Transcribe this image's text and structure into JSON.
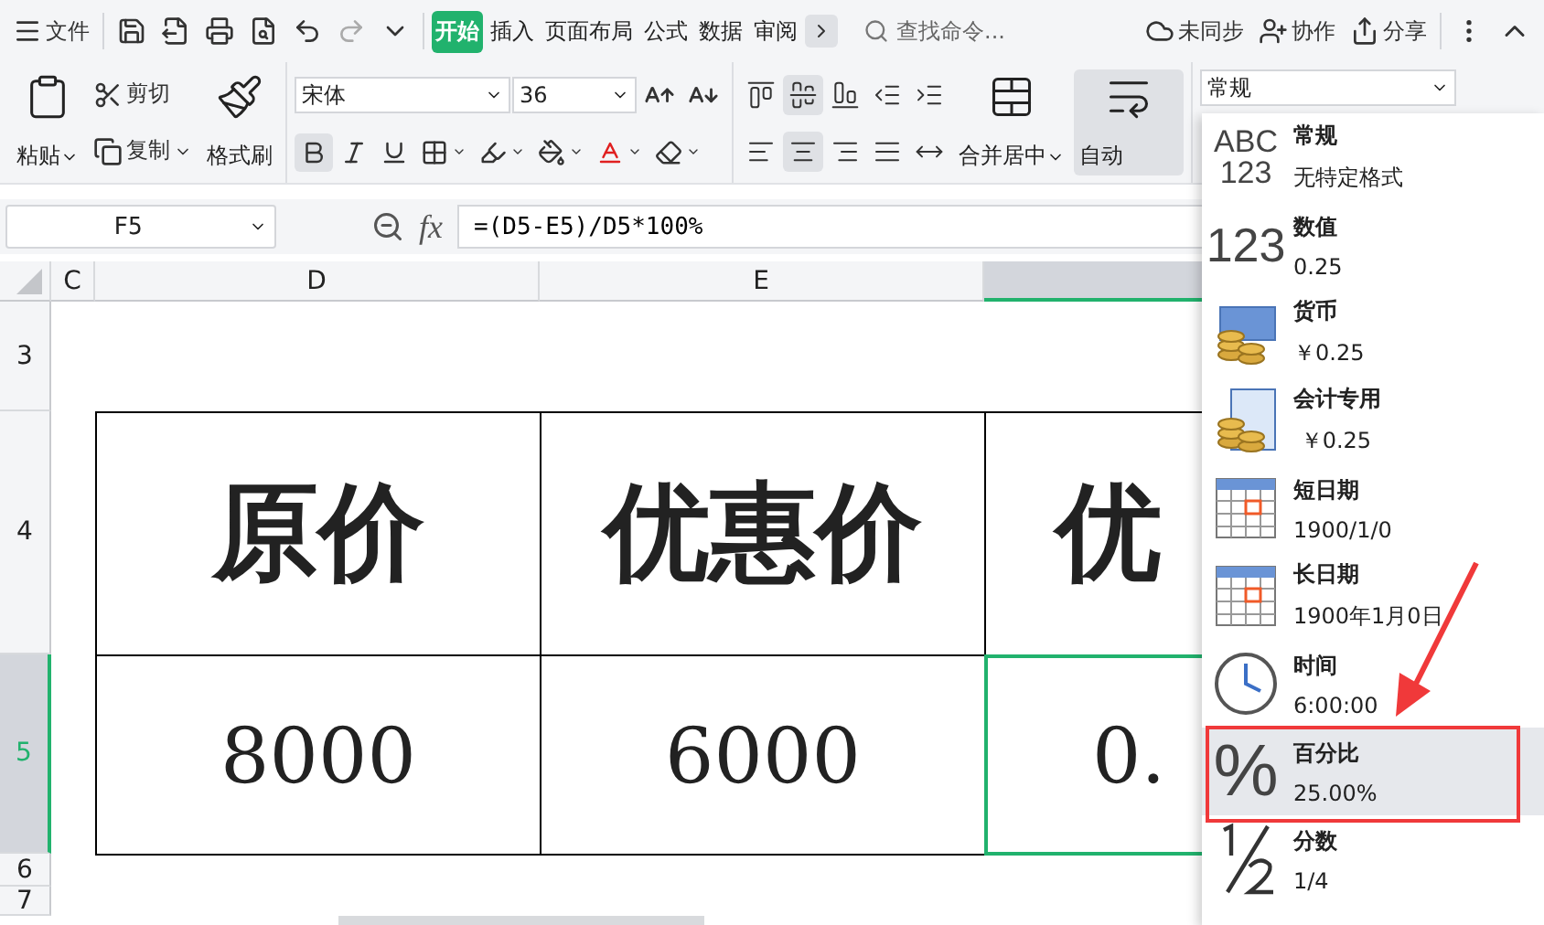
{
  "menubar": {
    "file_label": "文件",
    "tabs": [
      {
        "label": "开始",
        "selected": true
      },
      {
        "label": "插入",
        "selected": false
      },
      {
        "label": "页面布局",
        "selected": false
      },
      {
        "label": "公式",
        "selected": false
      },
      {
        "label": "数据",
        "selected": false
      },
      {
        "label": "审阅",
        "selected": false
      }
    ],
    "search": {
      "placeholder": "查找命令..."
    },
    "actions": [
      {
        "kind": "cloud",
        "label": "未同步"
      },
      {
        "kind": "person",
        "label": "协作"
      },
      {
        "kind": "share",
        "label": "分享"
      }
    ]
  },
  "ribbon": {
    "paste": "粘贴",
    "cut": "剪切",
    "copy": "复制",
    "format_painter": "格式刷",
    "font": {
      "name": "宋体",
      "size": "36",
      "bold": true
    },
    "align_buttons": [
      {
        "kind": "top",
        "selected": false
      },
      {
        "kind": "middle",
        "selected": true
      },
      {
        "kind": "bottom",
        "selected": false
      },
      {
        "kind": "outdent",
        "selected": false
      },
      {
        "kind": "indent",
        "selected": false
      },
      {
        "kind": "left",
        "selected": false
      },
      {
        "kind": "center",
        "selected": true
      },
      {
        "kind": "right",
        "selected": false
      },
      {
        "kind": "justify",
        "selected": false
      },
      {
        "kind": "distribute",
        "selected": false
      }
    ],
    "merge": "合并居中",
    "wrap": {
      "label": "自动",
      "on": true
    },
    "number_format": "常规"
  },
  "formula_bar": {
    "cell": "F5",
    "fx": "fx",
    "formula": "=(D5-E5)/D5*100%"
  },
  "sheet": {
    "columns": [
      {
        "label": "C",
        "selected": false
      },
      {
        "label": "D",
        "selected": false
      },
      {
        "label": "E",
        "selected": false
      },
      {
        "selected": true
      }
    ],
    "rows": [
      {
        "label": "3",
        "selected": false,
        "cells": []
      },
      {
        "label": "4",
        "selected": false,
        "kind": "header",
        "cells": [
          {
            "text": ""
          },
          {
            "text": "原价",
            "selected": false
          },
          {
            "text": "优惠价",
            "selected": false
          },
          {
            "text": "优",
            "selected": false
          }
        ]
      },
      {
        "label": "5",
        "selected": true,
        "kind": "value",
        "cells": [
          {
            "text": ""
          },
          {
            "text": "8000",
            "selected": false
          },
          {
            "text": "6000",
            "selected": false
          },
          {
            "text": "0.",
            "selected": true
          }
        ]
      },
      {
        "label": "6",
        "selected": false,
        "cells": []
      },
      {
        "label": "7",
        "selected": false,
        "cells": []
      }
    ]
  },
  "format_menu": {
    "items": [
      {
        "kind": "general",
        "icon_lines": [
          "ABC",
          "123"
        ],
        "title": "常规",
        "example": "无特定格式",
        "selected": false
      },
      {
        "kind": "number",
        "icon_lines": [
          "123"
        ],
        "title": "数值",
        "example": "0.25",
        "selected": false
      },
      {
        "kind": "currency",
        "title": "货币",
        "example": "￥0.25",
        "selected": false
      },
      {
        "kind": "accounting",
        "title": "会计专用",
        "example": " ￥0.25",
        "selected": false
      },
      {
        "kind": "short_date",
        "title": "短日期",
        "example": "1900/1/0",
        "selected": false
      },
      {
        "kind": "long_date",
        "title": "长日期",
        "example": "1900年1月0日",
        "selected": false
      },
      {
        "kind": "time",
        "title": "时间",
        "example": "6:00:00",
        "selected": false
      },
      {
        "kind": "percent",
        "icon_lines": [
          "%"
        ],
        "title": "百分比",
        "example": "25.00%",
        "selected": true
      },
      {
        "kind": "fraction",
        "title": "分数",
        "example": "1/4",
        "selected": false
      }
    ]
  }
}
